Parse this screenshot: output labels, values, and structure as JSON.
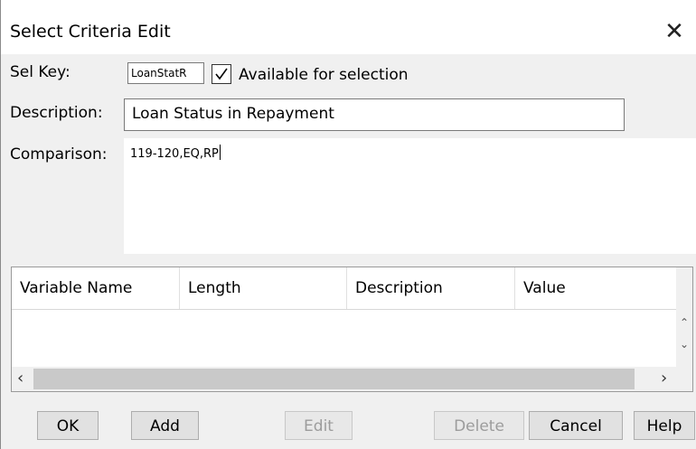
{
  "window": {
    "title": "Select Criteria Edit",
    "close_glyph": "✕"
  },
  "form": {
    "sel_key_label": "Sel Key:",
    "sel_key_value": "LoanStatR",
    "available_label": "Available for selection",
    "available_checked": true,
    "description_label": "Description:",
    "description_value": "Loan Status in Repayment",
    "comparison_label": "Comparison:",
    "comparison_value": "119-120,EQ,RP"
  },
  "grid": {
    "columns": [
      "Variable Name",
      "Length",
      "Description",
      "Value"
    ],
    "rows": []
  },
  "buttons": {
    "ok": "OK",
    "add": "Add",
    "edit": "Edit",
    "delete": "Delete",
    "cancel": "Cancel",
    "help": "Help"
  },
  "icons": {
    "close": "close-icon",
    "check": "checkmark-icon",
    "scroll_up": "chevron-up-icon",
    "scroll_down": "chevron-down-icon",
    "scroll_left": "chevron-left-icon",
    "scroll_right": "chevron-right-icon"
  }
}
